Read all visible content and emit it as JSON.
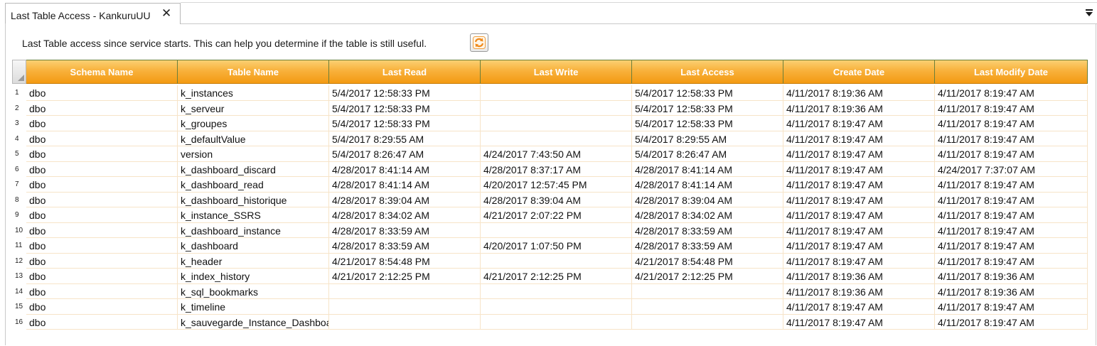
{
  "tab": {
    "title": "Last Table Access - KankuruUU",
    "close_glyph": "✕"
  },
  "description": "Last Table access since service starts. This can help you determine if the table is still useful.",
  "refresh_icon": "refresh-icon",
  "colors": {
    "header_top": "#fbd072",
    "header_bottom": "#f39a12",
    "refresh_orange": "#f08a1c"
  },
  "columns": [
    "Schema Name",
    "Table Name",
    "Last Read",
    "Last Write",
    "Last Access",
    "Create Date",
    "Last Modify Date"
  ],
  "rows": [
    {
      "n": "1",
      "cells": [
        "dbo",
        "k_instances",
        "5/4/2017 12:58:33 PM",
        "",
        "5/4/2017 12:58:33 PM",
        "4/11/2017 8:19:36 AM",
        "4/11/2017 8:19:47 AM"
      ]
    },
    {
      "n": "2",
      "cells": [
        "dbo",
        "k_serveur",
        "5/4/2017 12:58:33 PM",
        "",
        "5/4/2017 12:58:33 PM",
        "4/11/2017 8:19:36 AM",
        "4/11/2017 8:19:47 AM"
      ]
    },
    {
      "n": "3",
      "cells": [
        "dbo",
        "k_groupes",
        "5/4/2017 12:58:33 PM",
        "",
        "5/4/2017 12:58:33 PM",
        "4/11/2017 8:19:47 AM",
        "4/11/2017 8:19:47 AM"
      ]
    },
    {
      "n": "4",
      "cells": [
        "dbo",
        "k_defaultValue",
        "5/4/2017 8:29:55 AM",
        "",
        "5/4/2017 8:29:55 AM",
        "4/11/2017 8:19:47 AM",
        "4/11/2017 8:19:47 AM"
      ]
    },
    {
      "n": "5",
      "cells": [
        "dbo",
        "version",
        "5/4/2017 8:26:47 AM",
        "4/24/2017 7:43:50 AM",
        "5/4/2017 8:26:47 AM",
        "4/11/2017 8:19:47 AM",
        "4/11/2017 8:19:47 AM"
      ]
    },
    {
      "n": "6",
      "cells": [
        "dbo",
        "k_dashboard_discard",
        "4/28/2017 8:41:14 AM",
        "4/28/2017 8:37:17 AM",
        "4/28/2017 8:41:14 AM",
        "4/11/2017 8:19:47 AM",
        "4/24/2017 7:37:07 AM"
      ]
    },
    {
      "n": "7",
      "cells": [
        "dbo",
        "k_dashboard_read",
        "4/28/2017 8:41:14 AM",
        "4/20/2017 12:57:45 PM",
        "4/28/2017 8:41:14 AM",
        "4/11/2017 8:19:47 AM",
        "4/11/2017 8:19:47 AM"
      ]
    },
    {
      "n": "8",
      "cells": [
        "dbo",
        "k_dashboard_historique",
        "4/28/2017 8:39:04 AM",
        "4/28/2017 8:39:04 AM",
        "4/28/2017 8:39:04 AM",
        "4/11/2017 8:19:47 AM",
        "4/11/2017 8:19:47 AM"
      ]
    },
    {
      "n": "9",
      "cells": [
        "dbo",
        "k_instance_SSRS",
        "4/28/2017 8:34:02 AM",
        "4/21/2017 2:07:22 PM",
        "4/28/2017 8:34:02 AM",
        "4/11/2017 8:19:47 AM",
        "4/11/2017 8:19:47 AM"
      ]
    },
    {
      "n": "10",
      "cells": [
        "dbo",
        "k_dashboard_instance",
        "4/28/2017 8:33:59 AM",
        "",
        "4/28/2017 8:33:59 AM",
        "4/11/2017 8:19:47 AM",
        "4/11/2017 8:19:47 AM"
      ]
    },
    {
      "n": "11",
      "cells": [
        "dbo",
        "k_dashboard",
        "4/28/2017 8:33:59 AM",
        "4/20/2017 1:07:50 PM",
        "4/28/2017 8:33:59 AM",
        "4/11/2017 8:19:47 AM",
        "4/11/2017 8:19:47 AM"
      ]
    },
    {
      "n": "12",
      "cells": [
        "dbo",
        "k_header",
        "4/21/2017 8:54:48 PM",
        "",
        "4/21/2017 8:54:48 PM",
        "4/11/2017 8:19:47 AM",
        "4/11/2017 8:19:47 AM"
      ]
    },
    {
      "n": "13",
      "cells": [
        "dbo",
        "k_index_history",
        "4/21/2017 2:12:25 PM",
        "4/21/2017 2:12:25 PM",
        "4/21/2017 2:12:25 PM",
        "4/11/2017 8:19:36 AM",
        "4/11/2017 8:19:36 AM"
      ]
    },
    {
      "n": "14",
      "cells": [
        "dbo",
        "k_sql_bookmarks",
        "",
        "",
        "",
        "4/11/2017 8:19:36 AM",
        "4/11/2017 8:19:36 AM"
      ]
    },
    {
      "n": "15",
      "cells": [
        "dbo",
        "k_timeline",
        "",
        "",
        "",
        "4/11/2017 8:19:47 AM",
        "4/11/2017 8:19:47 AM"
      ]
    },
    {
      "n": "16",
      "cells": [
        "dbo",
        "k_sauvegarde_Instance_Dashboar",
        "",
        "",
        "",
        "4/11/2017 8:19:47 AM",
        "4/11/2017 8:19:47 AM"
      ]
    }
  ]
}
